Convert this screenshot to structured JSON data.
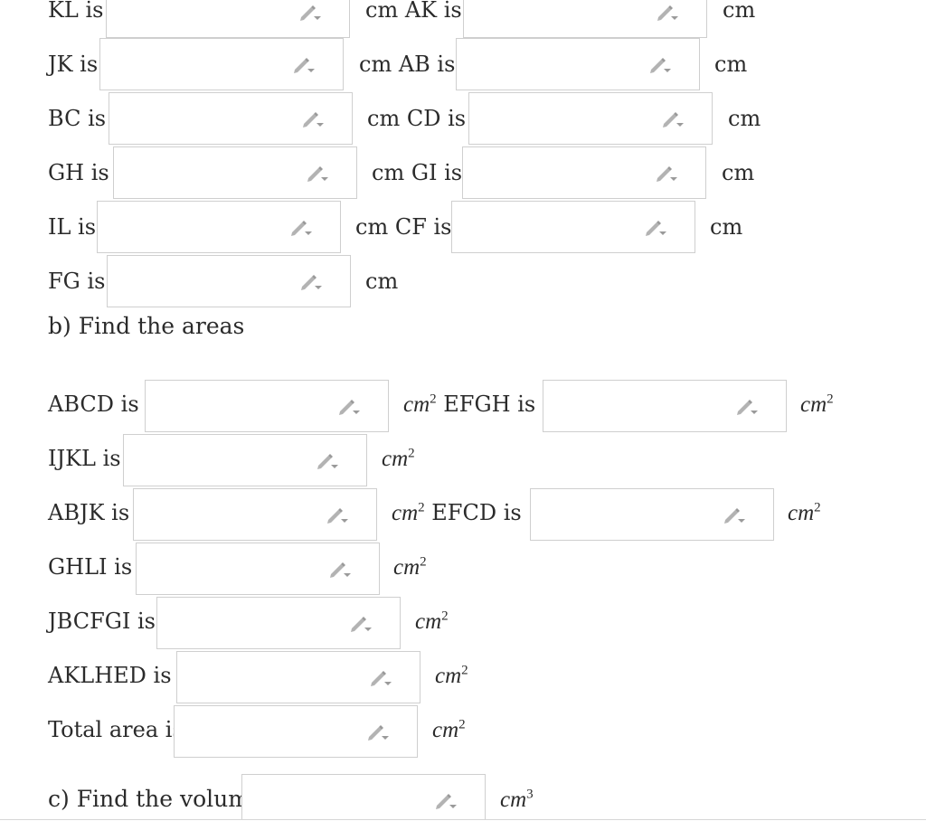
{
  "part_a": {
    "rows": [
      {
        "label1": "KL is",
        "unit1": "cm AK is",
        "unit2": "cm"
      },
      {
        "label1": "JK is",
        "unit1": "cm AB is",
        "unit2": "cm"
      },
      {
        "label1": "BC is",
        "unit1": "cm CD is",
        "unit2": "cm"
      },
      {
        "label1": "GH is",
        "unit1": "cm GI is",
        "unit2": "cm"
      },
      {
        "label1": "IL is",
        "unit1": "cm CF is",
        "unit2": "cm"
      },
      {
        "label1": "FG is",
        "unit1": "cm"
      }
    ]
  },
  "part_b": {
    "heading": "b) Find the areas",
    "rows": [
      {
        "label1": "ABCD is",
        "unit_base": "cm",
        "unit_exp": "2",
        "label2": " EFGH is",
        "unit2_base": "cm",
        "unit2_exp": "2"
      },
      {
        "label1": "IJKL is",
        "unit_base": "cm",
        "unit_exp": "2"
      },
      {
        "label1": "ABJK is",
        "unit_base": "cm",
        "unit_exp": "2",
        "label2": " EFCD is",
        "unit2_base": "cm",
        "unit2_exp": "2"
      },
      {
        "label1": "GHLI is",
        "unit_base": "cm",
        "unit_exp": "2"
      },
      {
        "label1": "JBCFGI is",
        "unit_base": "cm",
        "unit_exp": "2"
      },
      {
        "label1": "AKLHED is",
        "unit_base": "cm",
        "unit_exp": "2"
      },
      {
        "label1": "Total area is",
        "unit_base": "cm",
        "unit_exp": "2"
      }
    ]
  },
  "part_c": {
    "label": "c) Find the volume",
    "unit_base": "cm",
    "unit_exp": "3"
  },
  "icons": {
    "input_edit": "pencil-edit-icon"
  },
  "colors": {
    "input_border": "#cfcfcf",
    "icon": "#a9a9a9",
    "text": "#2b2b2b"
  }
}
